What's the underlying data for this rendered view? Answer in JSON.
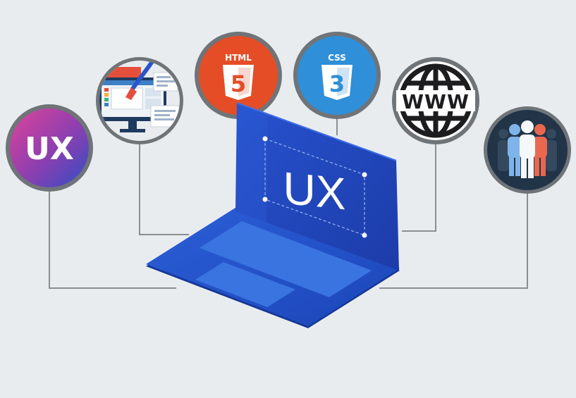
{
  "badges": {
    "ux": {
      "label": "UX"
    },
    "html": {
      "label": "HTML",
      "digit": "5"
    },
    "css": {
      "label": "CSS",
      "digit": "3"
    },
    "www": {
      "label": "WWW"
    }
  },
  "laptop": {
    "screen_label": "UX"
  },
  "colors": {
    "background": "#e9ecef",
    "ring": "#6f7479",
    "connector": "#8a8e92",
    "laptop_blue": "#1f4fc4",
    "laptop_dark": "#1a3aa0",
    "html_orange": "#e44d26",
    "css_blue": "#2f8fd8",
    "ux_gradient_start": "#e0439a",
    "ux_gradient_end": "#3a4bc0"
  },
  "icons": [
    "ux-icon",
    "design-tools-icon",
    "html5-icon",
    "css3-icon",
    "www-globe-icon",
    "users-group-icon",
    "laptop-icon"
  ]
}
